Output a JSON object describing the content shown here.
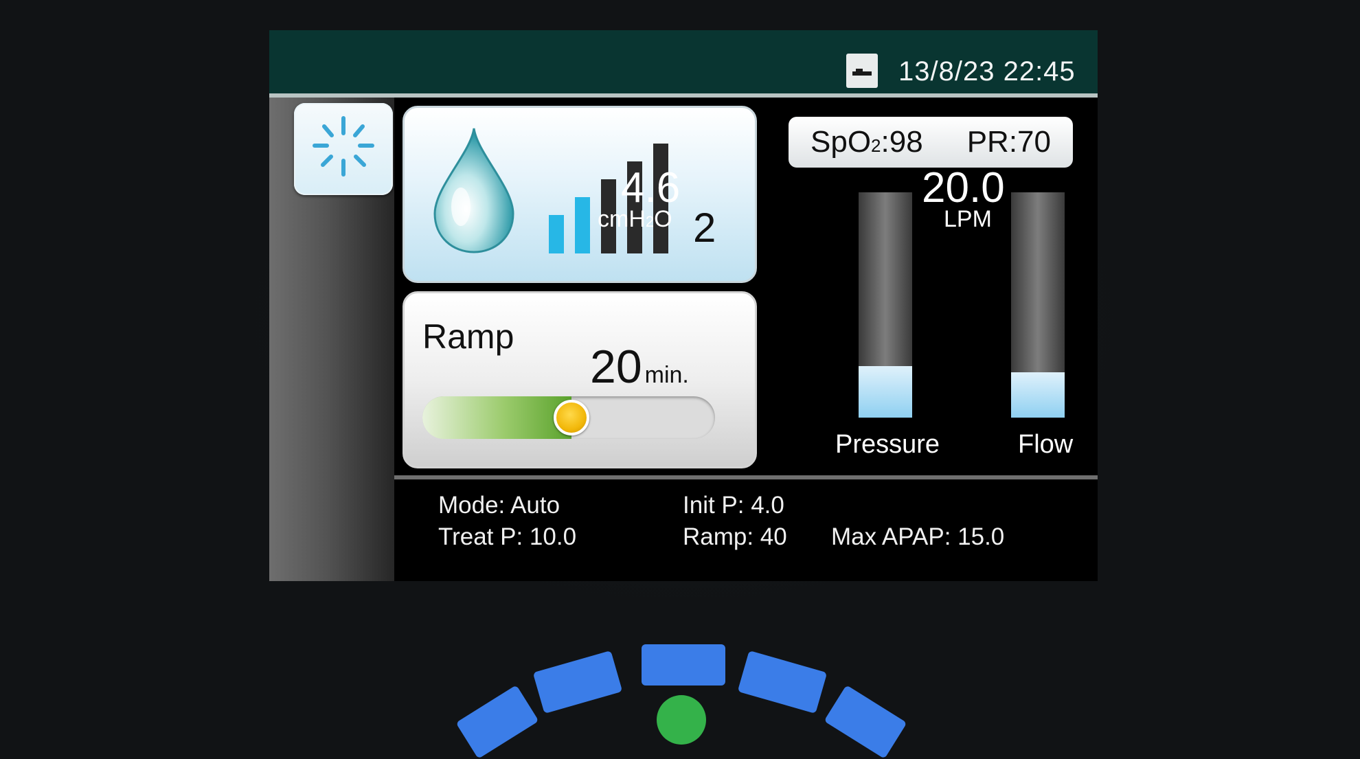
{
  "status_bar": {
    "sd_card_icon": "sd-card-icon",
    "datetime": "13/8/23 22:45"
  },
  "power_button": {
    "icon": "power-icon"
  },
  "humidifier": {
    "icon": "water-drop-icon",
    "level": "2",
    "level_of_5": 2,
    "bar_colors": {
      "active": "#27b7e6",
      "inactive": "#2a2a2a"
    }
  },
  "ramp": {
    "label": "Ramp",
    "value": "20",
    "unit": "min.",
    "slider_fraction": 0.51
  },
  "vitals": {
    "spo2_label": "SpO",
    "spo2_sub": "2",
    "spo2_value": ":98",
    "pr_label": "PR",
    "pr_value": ":70"
  },
  "pressure": {
    "value": "4.6",
    "unit_prefix": "cmH",
    "unit_sub": "2",
    "unit_suffix": "O",
    "label": "Pressure",
    "fill_fraction": 0.23
  },
  "flow": {
    "value": "20.0",
    "unit": "LPM",
    "label": "Flow",
    "fill_fraction": 0.2
  },
  "settings": {
    "mode": "Mode: Auto",
    "treat_p": "Treat P: 10.0",
    "init_p": "Init P: 4.0",
    "ramp": "Ramp: 40",
    "max_apap": "Max APAP: 15.0"
  },
  "colors": {
    "status_bar": "#093531",
    "dial_segments": "#3b7de8",
    "power_led": "#34b24a"
  }
}
